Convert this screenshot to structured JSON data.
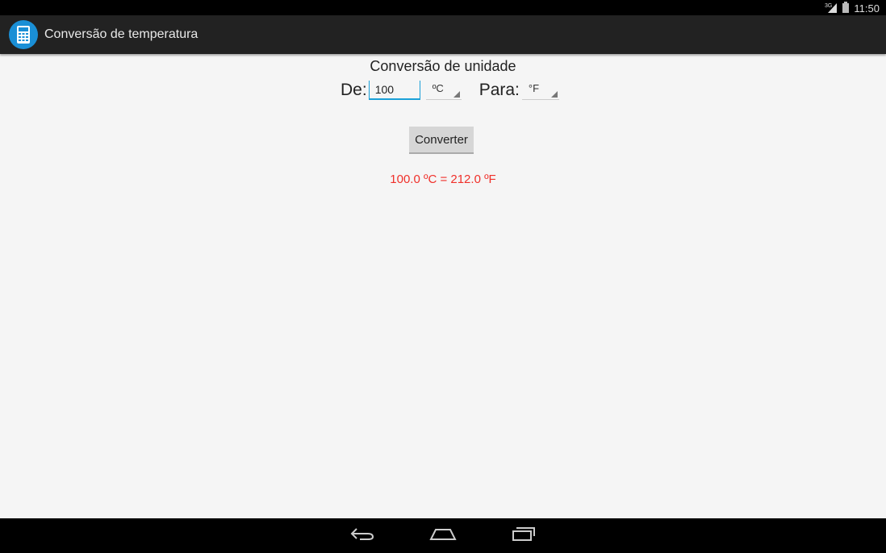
{
  "status_bar": {
    "time": "11:50",
    "network": "3G",
    "icons": [
      "signal-icon",
      "battery-icon"
    ]
  },
  "app_bar": {
    "title": "Conversão de temperatura",
    "icon": "calculator-icon"
  },
  "main": {
    "heading": "Conversão de unidade",
    "from_label": "De:",
    "from_value": "100",
    "from_unit": "ºC",
    "to_label": "Para:",
    "to_unit": "°F",
    "convert_label": "Converter",
    "result": "100.0 ºC = 212.0 ºF",
    "result_color": "#f0302a"
  },
  "nav_bar": {
    "icons": [
      "back-icon",
      "home-icon",
      "recents-icon"
    ]
  }
}
